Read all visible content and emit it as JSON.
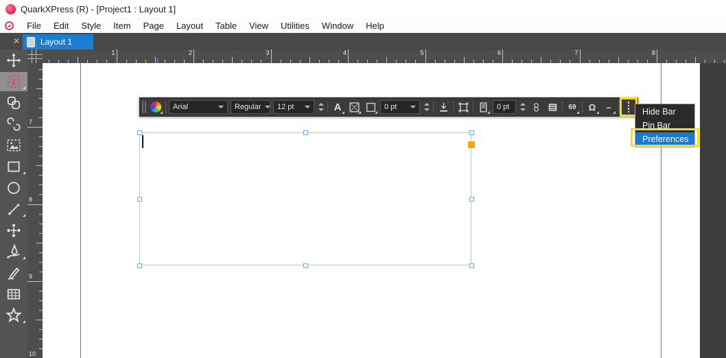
{
  "window": {
    "title": "QuarkXPress (R) - [Project1 : Layout 1]"
  },
  "menu_bar": {
    "items": [
      "File",
      "Edit",
      "Style",
      "Item",
      "Page",
      "Layout",
      "Table",
      "View",
      "Utilities",
      "Window",
      "Help"
    ]
  },
  "tab_bar": {
    "active_tab": "Layout 1",
    "close_glyph": "✕"
  },
  "toolbar": {
    "font_family": "Arial",
    "font_style": "Regular",
    "font_size": "12 pt",
    "stroke_width": "0 pt",
    "spacing_value": "0 pt",
    "text_color_glyph": "A",
    "quotes_glyph": "69",
    "omega_glyph": "Ω",
    "dash_glyph": "–"
  },
  "context_menu": {
    "items": [
      "Hide Bar",
      "Pin Bar",
      "Preferences"
    ],
    "selected": "Preferences"
  },
  "rulers": {
    "horizontal_numbers": [
      1,
      2,
      3,
      4,
      5,
      6,
      7,
      8
    ],
    "vertical_numbers": [
      7,
      8,
      9,
      10
    ]
  },
  "colors": {
    "accent_blue": "#1b7ed3",
    "selection_blue": "#1879d0",
    "annotation_yellow": "#ffe000",
    "guide_blue": "#6565e6",
    "handle_orange": "#f2a60d",
    "text_tool_red": "#ef3b5d"
  }
}
